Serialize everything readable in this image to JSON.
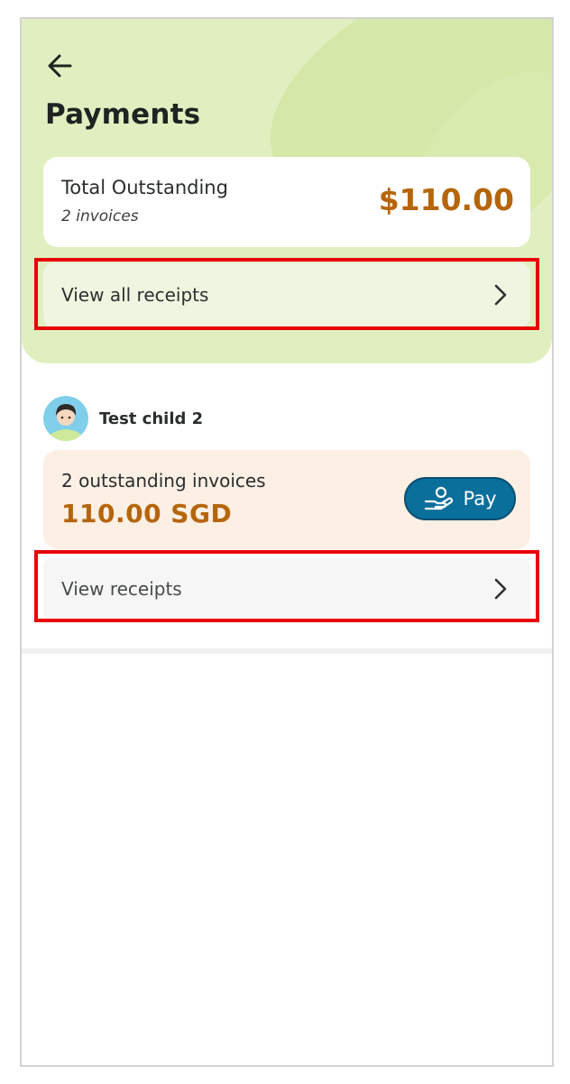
{
  "header": {
    "title": "Payments",
    "back_icon": "arrow-left-icon"
  },
  "summary": {
    "label": "Total Outstanding",
    "invoice_count_text": "2 invoices",
    "amount": "$110.00",
    "amount_color": "#b5650a"
  },
  "view_all_receipts": {
    "label": "View all receipts",
    "icon": "chevron-right-icon"
  },
  "children": [
    {
      "name": "Test child 2",
      "avatar_icon": "child-avatar-icon",
      "outstanding_text": "2 outstanding invoices",
      "amount": "110.00 SGD",
      "pay_button_label": "Pay",
      "pay_icon": "hand-coins-icon",
      "view_receipts_label": "View receipts"
    }
  ],
  "colors": {
    "hero_bg": "#e1efc0",
    "accent_amount": "#b5650a",
    "pay_button": "#0b6f9c",
    "highlight": "#e8050a"
  }
}
